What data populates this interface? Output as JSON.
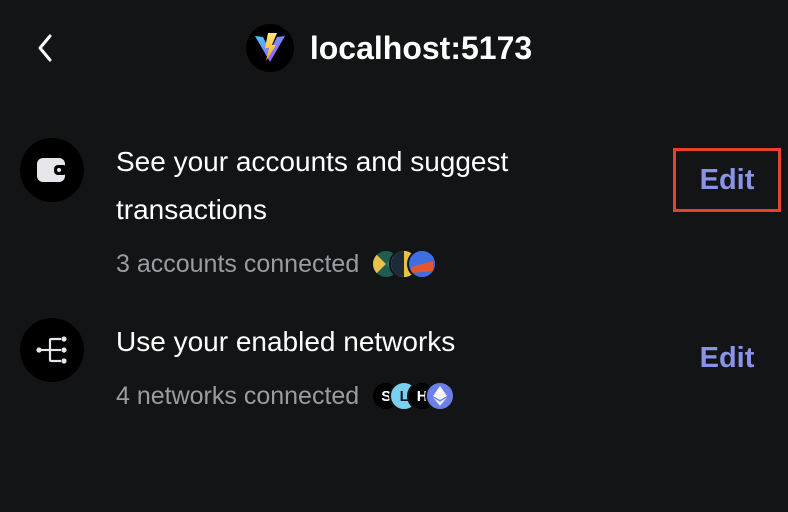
{
  "header": {
    "back_icon": "chevron-left-icon",
    "site_icon": "vite-logo-icon",
    "site_title": "localhost:5173"
  },
  "permissions": [
    {
      "icon": "wallet-icon",
      "title": "See your accounts and suggest transactions",
      "subtitle": "3 accounts connected",
      "edit_label": "Edit",
      "highlighted": true,
      "avatars": [
        "account-avatar-1",
        "account-avatar-2",
        "account-avatar-3"
      ]
    },
    {
      "icon": "network-icon",
      "title": "Use your enabled networks",
      "subtitle": "4 networks connected",
      "edit_label": "Edit",
      "highlighted": false,
      "avatars": [
        {
          "name": "network-avatar-s",
          "text": "S"
        },
        {
          "name": "network-avatar-l",
          "text": "L"
        },
        {
          "name": "network-avatar-h",
          "text": "H"
        },
        {
          "name": "ethereum-icon",
          "text": ""
        }
      ]
    }
  ],
  "colors": {
    "background": "#131416",
    "accent": "#8b93e6",
    "highlight_border": "#e8412e",
    "muted_text": "#9b9ca3"
  }
}
